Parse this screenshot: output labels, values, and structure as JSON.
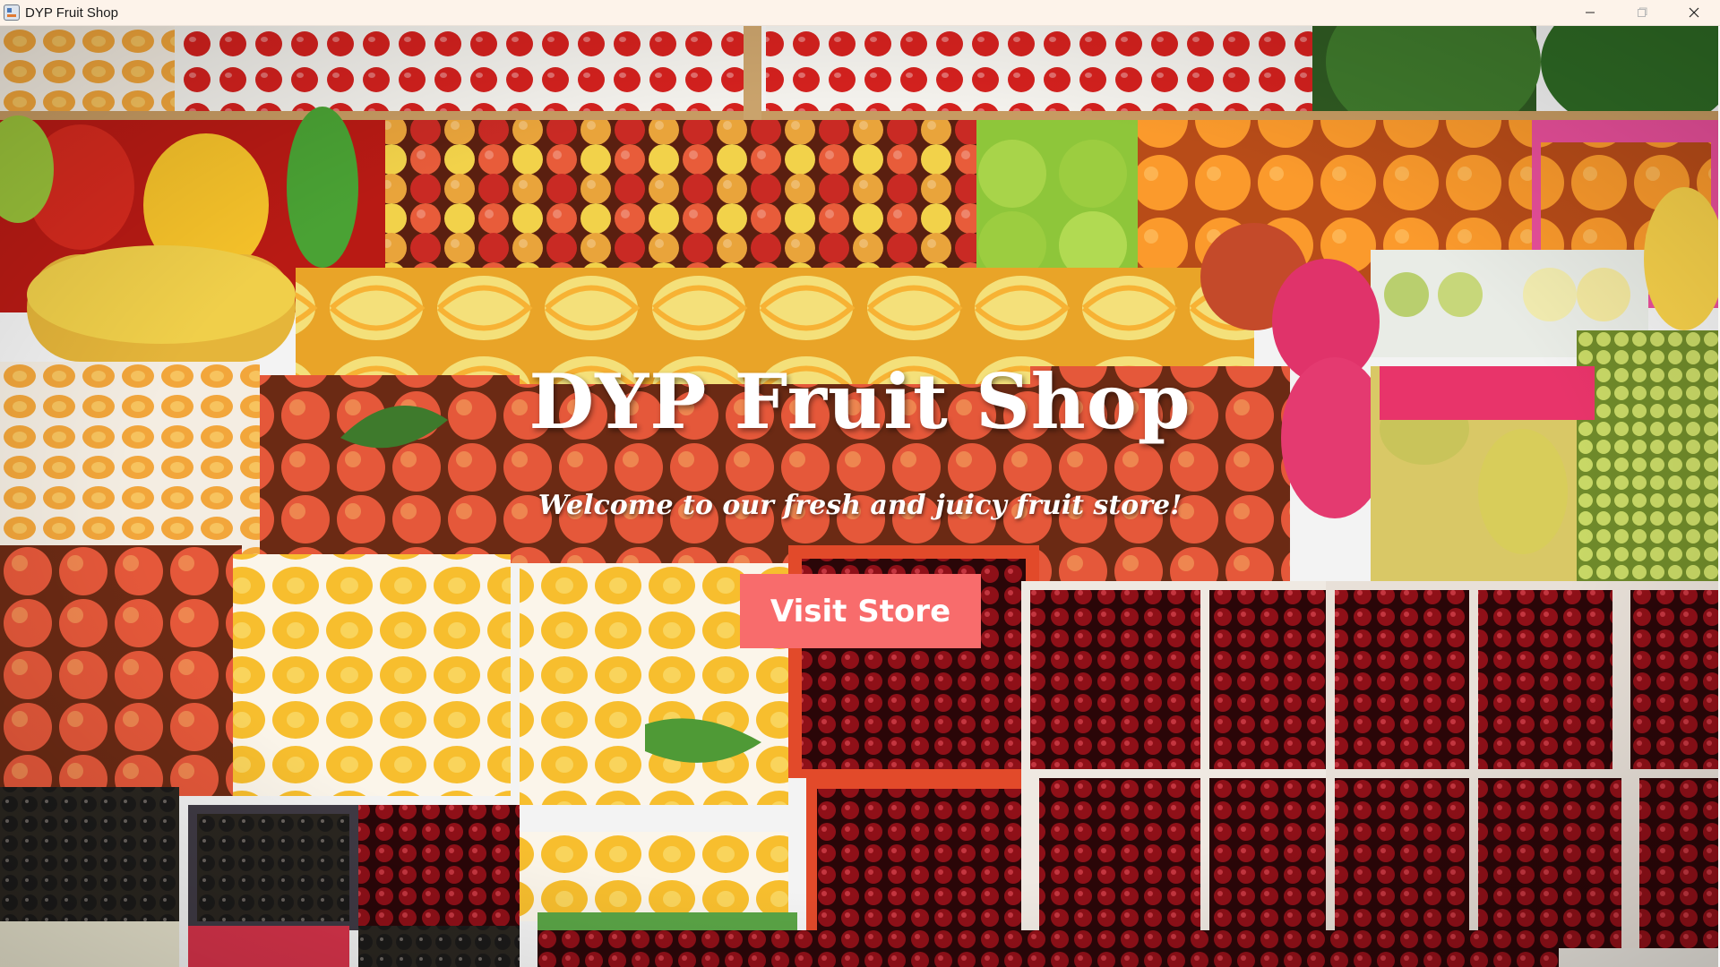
{
  "window": {
    "title": "DYP Fruit Shop",
    "app_icon": "java-app-icon",
    "controls": [
      "minimize-icon",
      "maximize-icon",
      "close-icon"
    ]
  },
  "hero": {
    "title": "DYP Fruit Shop",
    "subtitle": "Welcome to our fresh and juicy fruit store!",
    "button_label": "Visit Store"
  },
  "background": {
    "description_icon": "fruit-market-photo",
    "colors": {
      "button": "#f86c6c",
      "text": "#ffffff",
      "titlebar": "#fdf3ea"
    }
  }
}
